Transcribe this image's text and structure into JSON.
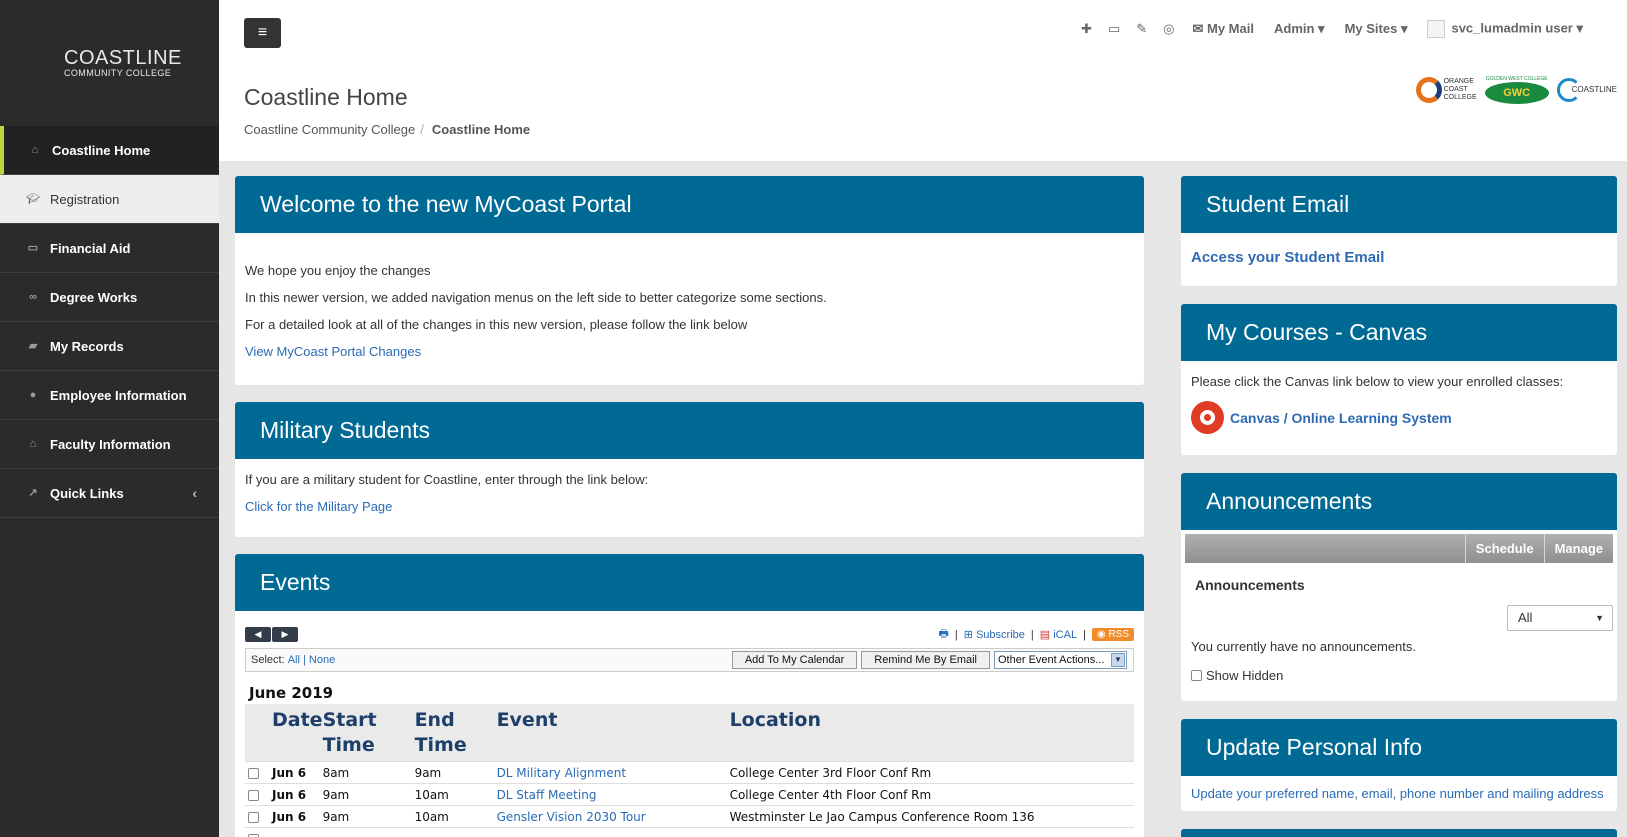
{
  "logo": {
    "line1": "COASTLINE",
    "line2": "COMMUNITY COLLEGE"
  },
  "sidebar": {
    "items": [
      {
        "label": "Coastline Home",
        "icon": "home-icon"
      },
      {
        "label": "Registration",
        "icon": "graduation-cap-icon"
      },
      {
        "label": "Financial Aid",
        "icon": "money-icon"
      },
      {
        "label": "Degree Works",
        "icon": "binoculars-icon"
      },
      {
        "label": "My Records",
        "icon": "folder-open-icon"
      },
      {
        "label": "Employee Information",
        "icon": "user-icon"
      },
      {
        "label": "Faculty Information",
        "icon": "institution-icon"
      },
      {
        "label": "Quick Links",
        "icon": "external-link-icon"
      }
    ]
  },
  "topnav": {
    "my_mail": "My Mail",
    "admin": "Admin",
    "my_sites": "My Sites",
    "user": "svc_lumadmin user"
  },
  "header": {
    "title": "Coastline Home",
    "breadcrumb": [
      "Coastline Community College",
      "Coastline Home"
    ],
    "college_logos": {
      "occ": [
        "ORANGE",
        "COAST",
        "COLLEGE"
      ],
      "gwc": "GWC",
      "gwc_top": "GOLDEN WEST COLLEGE",
      "ccc": "COASTLINE"
    }
  },
  "welcome": {
    "title": "Welcome to the new MyCoast Portal",
    "lines": [
      "We hope you enjoy the changes",
      "In this newer version, we added navigation menus on the left side to better categorize some sections.",
      "For a detailed look at all of the changes in this new version, please follow the link below"
    ],
    "link": "View MyCoast Portal Changes"
  },
  "military": {
    "title": "Military Students",
    "text": "If you are a military student for Coastline, enter through the link below:",
    "link": "Click for the Military Page"
  },
  "events": {
    "title": "Events",
    "subscribe": "Subscribe",
    "ical": "iCAL",
    "rss": "RSS",
    "select_label": "Select:",
    "select_all": "All",
    "select_none": "None",
    "add_calendar": "Add To My Calendar",
    "remind": "Remind Me By Email",
    "other_actions": "Other Event Actions...",
    "month": "June 2019",
    "columns": [
      "Date",
      "Start Time",
      "End Time",
      "Event",
      "Location"
    ],
    "rows": [
      {
        "date": "Jun 6",
        "start": "8am",
        "end": "9am",
        "event": "DL Military Alignment",
        "location": "College Center 3rd Floor Conf Rm"
      },
      {
        "date": "Jun 6",
        "start": "9am",
        "end": "10am",
        "event": "DL Staff Meeting",
        "location": "College Center 4th Floor Conf Rm"
      },
      {
        "date": "Jun 6",
        "start": "9am",
        "end": "10am",
        "event": "Gensler Vision 2030 Tour",
        "location": "Westminster Le Jao Campus Conference Room 136"
      }
    ]
  },
  "student_email": {
    "title": "Student Email",
    "link": "Access your Student Email"
  },
  "courses": {
    "title": "My Courses - Canvas",
    "text": "Please click the Canvas link below to view your enrolled classes:",
    "link": "Canvas / Online Learning System"
  },
  "announcements": {
    "title": "Announcements",
    "schedule": "Schedule",
    "manage": "Manage",
    "subtitle": "Announcements",
    "filter": "All",
    "empty": "You currently have no announcements.",
    "show_hidden": "Show Hidden"
  },
  "personal": {
    "title": "Update Personal Info",
    "link": "Update your preferred name, email, phone number and mailing address"
  }
}
